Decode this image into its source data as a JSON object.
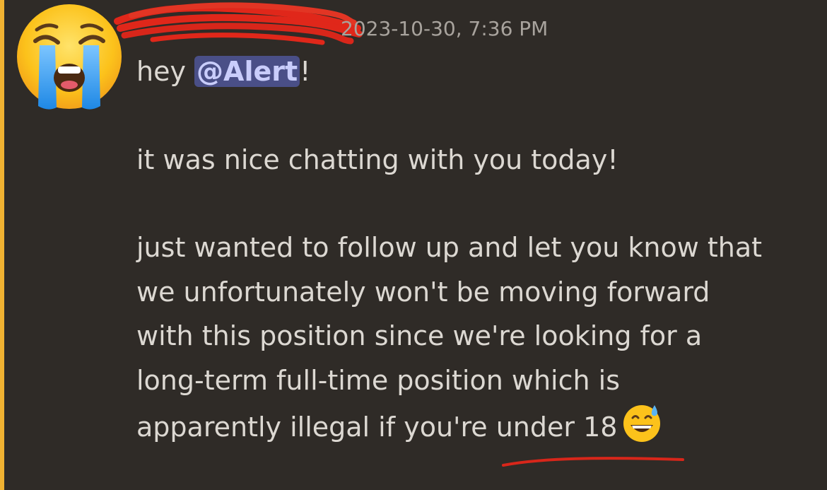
{
  "message": {
    "author_avatar": "loudly-crying-face-emoji",
    "author_name": "",
    "timestamp": "2023-10-30, 7:36 PM",
    "greeting_prefix": "hey",
    "mention": "@Alert",
    "greeting_suffix": "!",
    "line_two": "it was nice chatting with you today!",
    "body_lines": [
      "just wanted to follow up and let you know that",
      "we unfortunately won't be moving forward",
      "with this position since we're looking for a",
      "long-term full-time position which is",
      "apparently illegal if you're under 18"
    ],
    "trailing_emoji": "grinning-face-with-sweat-emoji"
  },
  "colors": {
    "background": "#2f2b27",
    "accent_bar": "#f0b232",
    "text": "#dcd8d2",
    "timestamp": "#a8a39d",
    "mention_bg": "#4a4f87",
    "mention_text": "#c9cdfb",
    "annotation_red": "#e0271a"
  },
  "annotations": {
    "redaction": "red-scribble-over-username",
    "underline": "red-underline-under-age-phrase"
  }
}
